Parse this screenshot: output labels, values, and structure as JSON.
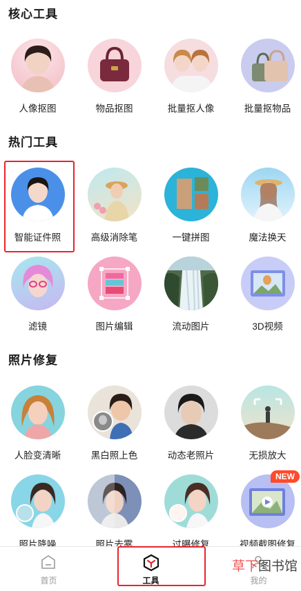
{
  "sections": {
    "core": "核心工具",
    "hot": "热门工具",
    "repair": "照片修复"
  },
  "core_tools": [
    {
      "label": "人像抠图",
      "icon": "portrait-cutout-icon"
    },
    {
      "label": "物品抠图",
      "icon": "object-cutout-icon"
    },
    {
      "label": "批量抠人像",
      "icon": "batch-portrait-icon"
    },
    {
      "label": "批量抠物品",
      "icon": "batch-object-icon"
    }
  ],
  "hot_tools": [
    {
      "label": "智能证件照",
      "icon": "id-photo-icon"
    },
    {
      "label": "高级消除笔",
      "icon": "eraser-icon"
    },
    {
      "label": "一键拼图",
      "icon": "collage-icon"
    },
    {
      "label": "魔法换天",
      "icon": "sky-replace-icon"
    },
    {
      "label": "滤镜",
      "icon": "filter-icon"
    },
    {
      "label": "图片编辑",
      "icon": "image-edit-icon"
    },
    {
      "label": "流动图片",
      "icon": "motion-image-icon"
    },
    {
      "label": "3D视频",
      "icon": "3d-video-icon"
    }
  ],
  "repair_tools": [
    {
      "label": "人脸变清晰",
      "icon": "face-sharpen-icon"
    },
    {
      "label": "黑白照上色",
      "icon": "colorize-icon"
    },
    {
      "label": "动态老照片",
      "icon": "animate-photo-icon"
    },
    {
      "label": "无损放大",
      "icon": "upscale-icon"
    },
    {
      "label": "照片降噪",
      "icon": "denoise-icon"
    },
    {
      "label": "照片去雾",
      "icon": "dehaze-icon"
    },
    {
      "label": "过曝修复",
      "icon": "overexposure-icon"
    },
    {
      "label": "视频截图修复",
      "icon": "video-frame-icon"
    }
  ],
  "badge": "NEW",
  "tabs": [
    {
      "label": "首页",
      "icon": "home-icon"
    },
    {
      "label": "工具",
      "icon": "tools-icon"
    },
    {
      "label": "我的",
      "icon": "profile-icon"
    }
  ],
  "watermark": {
    "part1": "草下",
    "part2": "图书馆"
  },
  "colors": {
    "highlight": "#e8232b",
    "badge": "#ff4a2b",
    "tab_active": "#111111",
    "tab_inactive": "#999999"
  }
}
